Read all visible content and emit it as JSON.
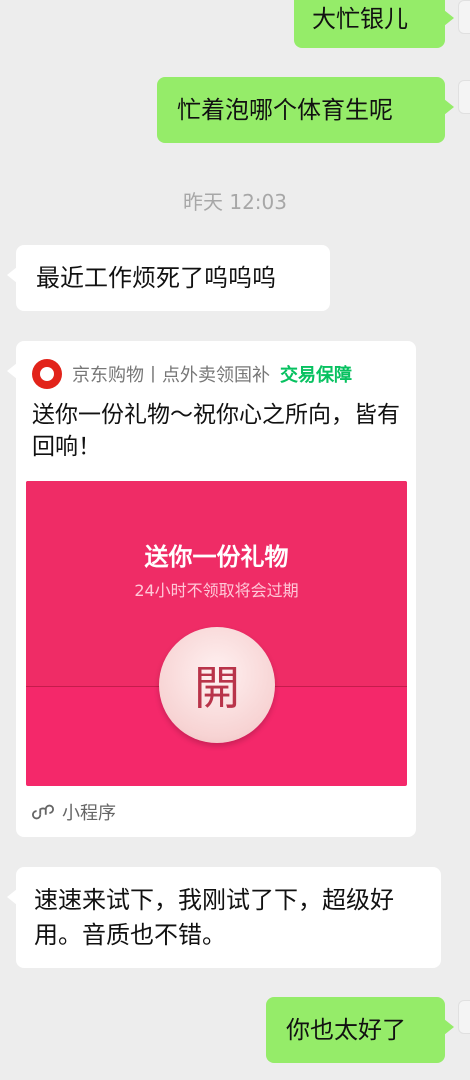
{
  "messages": {
    "m1": "大忙银儿",
    "m2": "忙着泡哪个体育生呢",
    "timestamp": "昨天 12:03",
    "m3": "最近工作烦死了呜呜呜",
    "m4": "速速来试下，我刚试了下，超级好用。音质也不错。",
    "m5": "你也太好了"
  },
  "card": {
    "source": "京东购物丨点外卖领国补",
    "guarantee": "交易保障",
    "description": "送你一份礼物～祝你心之所向，皆有回响！",
    "envelope_title": "送你一份礼物",
    "envelope_subtitle": "24小时不领取将会过期",
    "open_label": "開",
    "footer": "小程序"
  },
  "colors": {
    "chat_bg": "#ededed",
    "sent_bubble": "#95ec69",
    "received_bubble": "#ffffff",
    "envelope": "#f4286a",
    "guarantee": "#07c160"
  }
}
